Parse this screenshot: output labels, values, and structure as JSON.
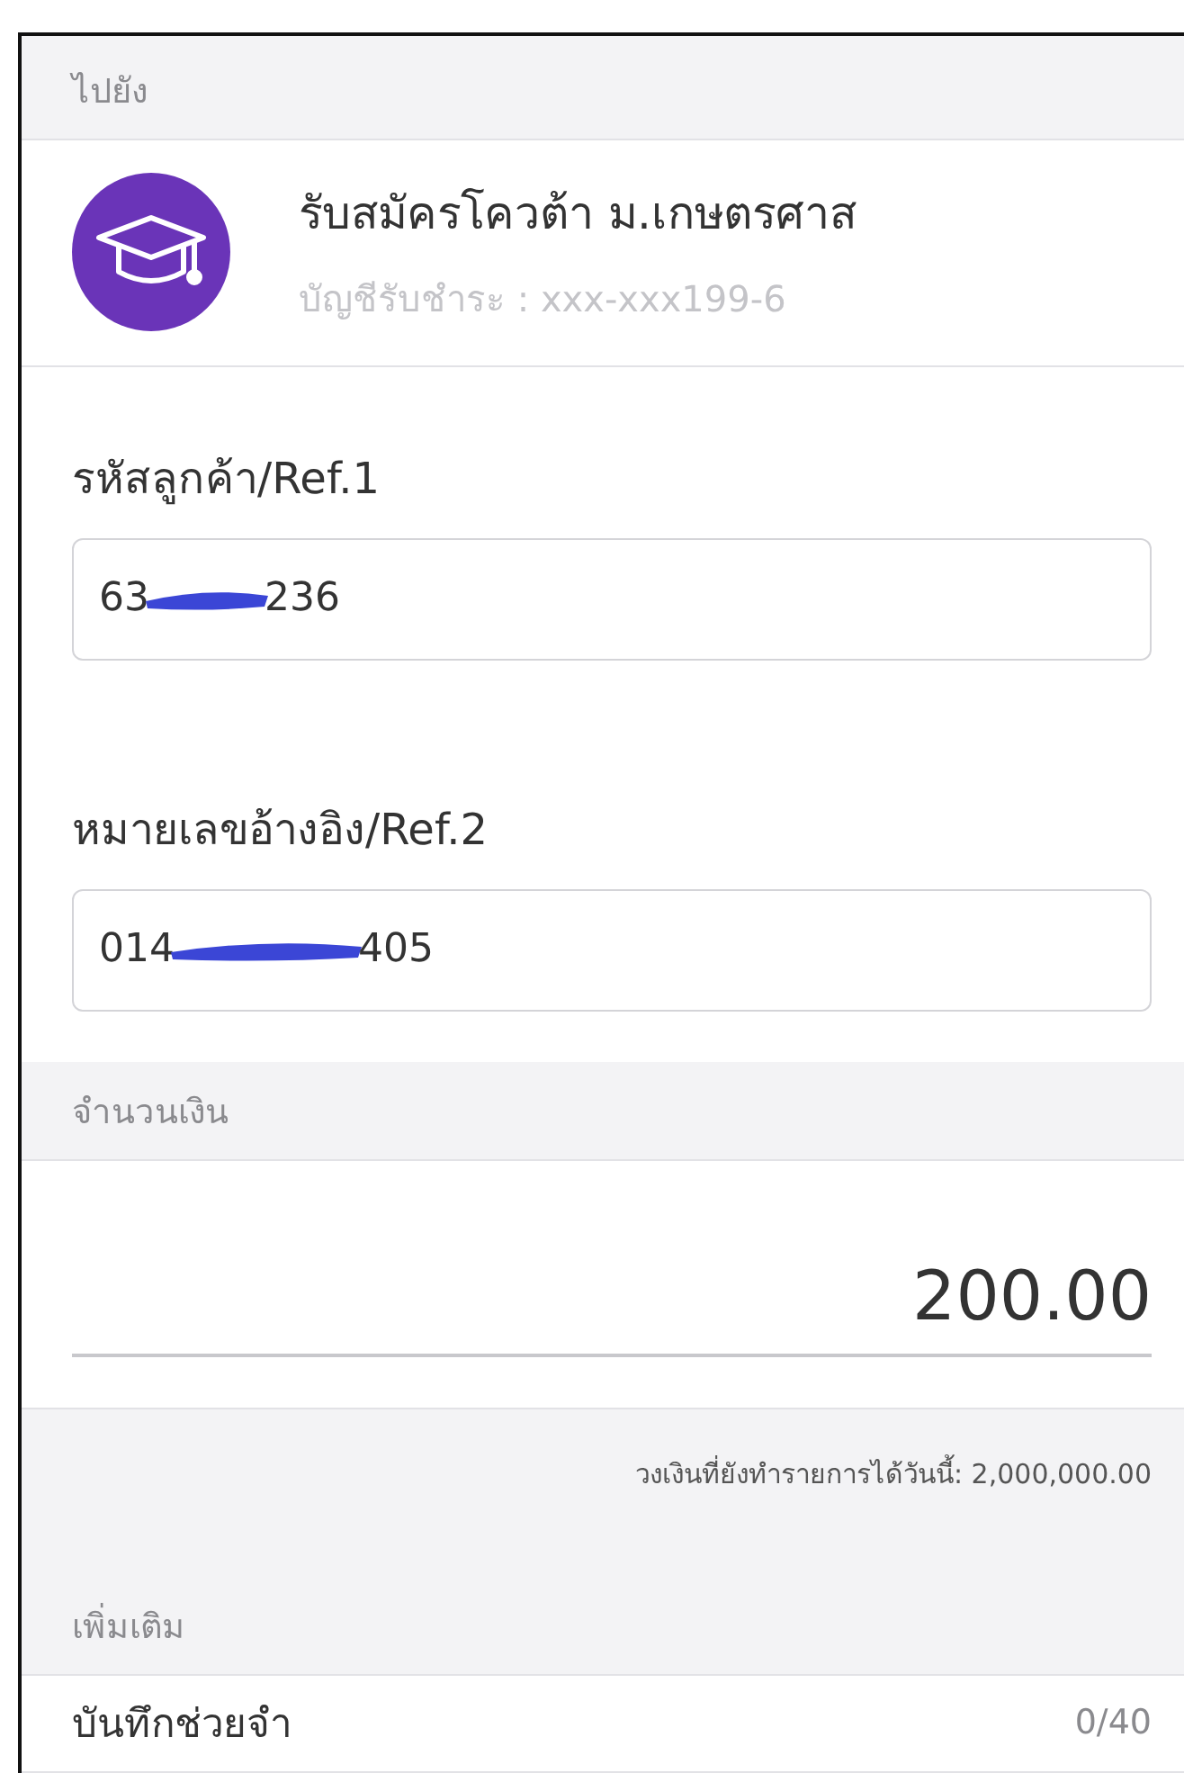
{
  "destination_header": "ไปยัง",
  "biller": {
    "name": "รับสมัครโควต้า ม.เกษตรศาส",
    "account": "บัญชีรับชำระ : xxx-xxx199-6"
  },
  "refs": [
    {
      "label": "รหัสลูกค้า/Ref.1",
      "value_start": "63",
      "value_end": "236",
      "redacted": true
    },
    {
      "label": "หมายเลขอ้างอิง/Ref.2",
      "value_start": "014",
      "value_end": "405",
      "redacted": true
    }
  ],
  "amount_header": "จำนวนเงิน",
  "amount": "200.00",
  "limit_note": "วงเงินที่ยังทำรายการได้วันนี้: 2,000,000.00",
  "more_header": "เพิ่มเติม",
  "memo": {
    "label": "บันทึกช่วยจำ",
    "counter": "0/40"
  }
}
